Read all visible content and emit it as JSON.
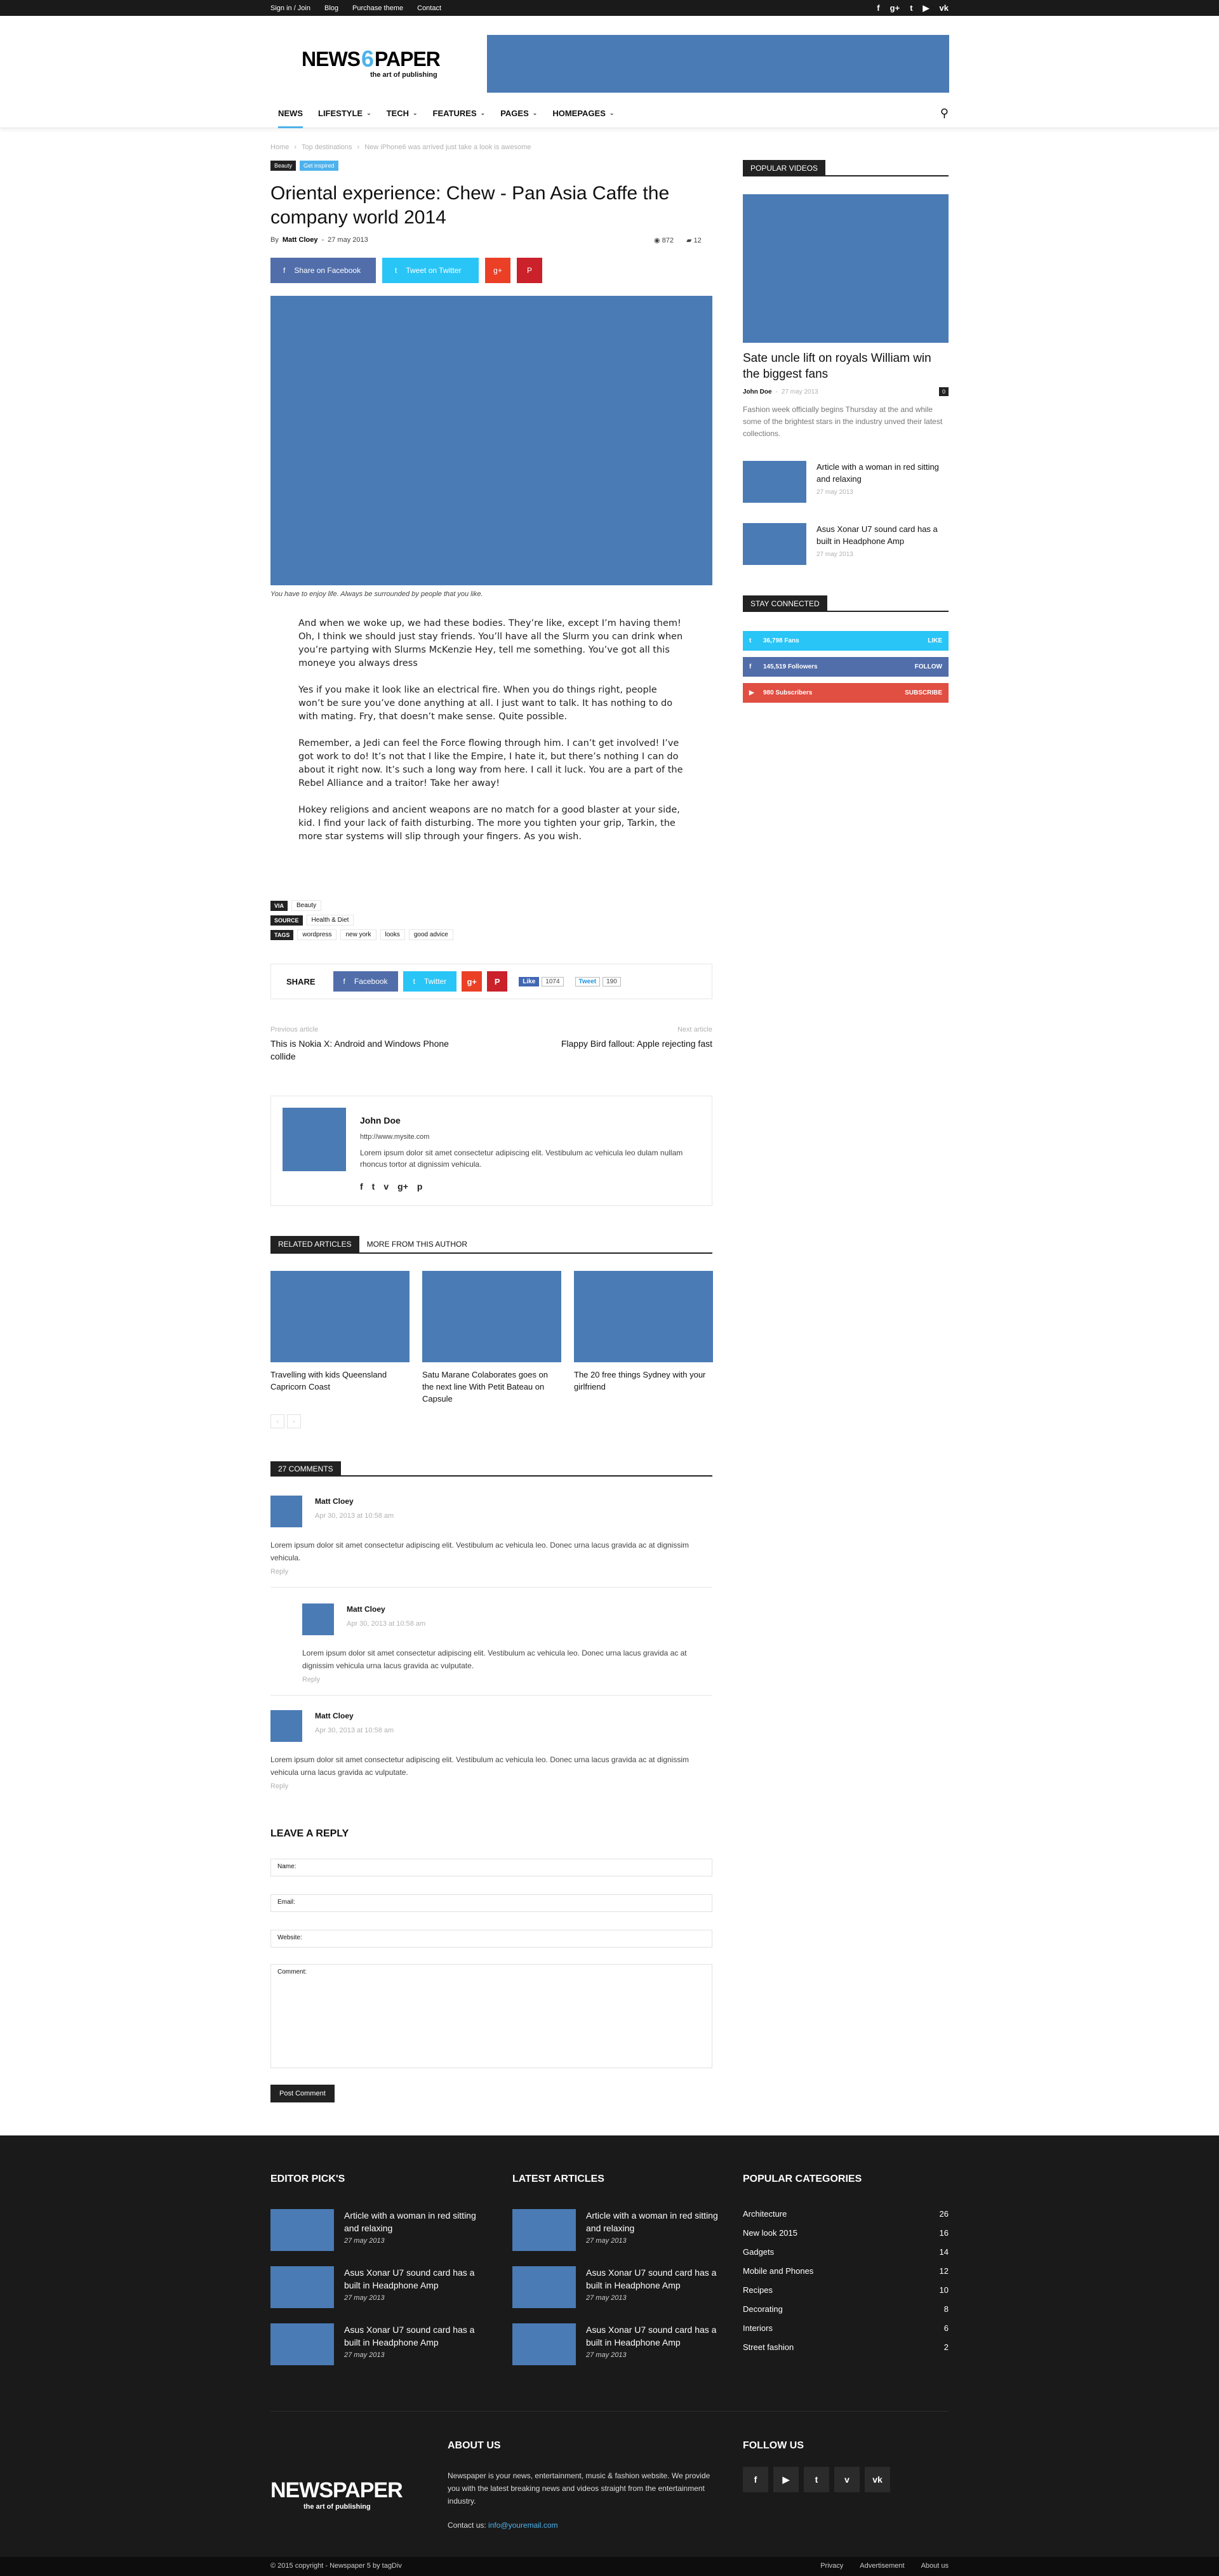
{
  "topbar": {
    "links": [
      "Sign in / Join",
      "Blog",
      "Purchase theme",
      "Contact"
    ],
    "social": [
      "f",
      "g+",
      "t",
      "▶",
      "vk"
    ]
  },
  "header": {
    "logo_text": "NEWS",
    "logo_mid": "6",
    "logo_text2": "PAPER",
    "logo_tag": "the art of publishing"
  },
  "nav": {
    "items": [
      {
        "label": "NEWS",
        "chev": ""
      },
      {
        "label": "LIFESTYLE",
        "chev": "⌄"
      },
      {
        "label": "TECH",
        "chev": "⌄"
      },
      {
        "label": "FEATURES",
        "chev": "⌄"
      },
      {
        "label": "PAGES",
        "chev": "⌄"
      },
      {
        "label": "HOMEPAGES",
        "chev": "⌄"
      }
    ],
    "search": "⚲"
  },
  "article": {
    "breadcrumbs": [
      "Home",
      "›",
      "Top destinations",
      "›",
      "New iPhone6 was arrived just take a look is awesome"
    ],
    "categories": [
      "Beauty",
      "Get inspired"
    ],
    "title": "Oriental experience: Chew - Pan Asia Caffe the company world 2014",
    "author_prefix": "By",
    "author": "Matt Cloey",
    "date_sep": "-",
    "date": "27 may 2013",
    "views": "872",
    "comments": "12",
    "share": {
      "facebook": "Share on Facebook",
      "twitter": "Tweet on Twitter",
      "gplus": "g+",
      "pinterest": "P"
    },
    "caption": "You have to enjoy life. Always be surrounded by people that you like.",
    "paragraphs": [
      "And when we woke up, we had these bodies. They’re like, except I’m having them! Oh, I think we should just stay friends. You’ll have all the Slurm you can drink when you’re partying with Slurms McKenzie Hey, tell me something. You’ve got all this moneye you always dress",
      "Yes if you make it look like an electrical fire. When you do things right, people won’t be sure you’ve done anything at all. I just want to talk. It has nothing to do with mating. Fry, that doesn’t make sense. Quite possible.",
      "Remember, a Jedi can feel the Force flowing through him. I can’t get involved! I’ve got work to do! It’s not that I like the Empire, I hate it, but there’s nothing I can do about it right now. It’s such a long way from here. I call it luck. You are a part of the Rebel Alliance and a traitor! Take her away!",
      "Hokey religions and ancient weapons are no match for a good blaster at your side, kid. I find your lack of faith disturbing. The more you tighten your grip, Tarkin, the more star systems will slip through your fingers. As you wish."
    ],
    "via": {
      "k": "VIA",
      "v": "Beauty"
    },
    "source": {
      "k": "SOURCE",
      "v": "Health & Diet"
    },
    "tags": {
      "k": "TAGS",
      "v": [
        "wordpress",
        "new york",
        "looks",
        "good advice"
      ]
    },
    "sharebox": {
      "label": "SHARE",
      "facebook": "Facebook",
      "twitter": "Twitter",
      "gplus": "g+",
      "pinterest": "P",
      "like": "Like",
      "like_count": "1074",
      "tweet": "Tweet",
      "tweet_count": "190"
    },
    "prev": {
      "label": "Previous article",
      "title": "This is Nokia X: Android and Windows Phone collide"
    },
    "next": {
      "label": "Next article",
      "title": "Flappy Bird fallout: Apple rejecting fast"
    },
    "authorbox": {
      "name": "John Doe",
      "url": "http://www.mysite.com",
      "desc": "Lorem ipsum dolor sit amet consectetur adipiscing elit. Vestibulum ac vehicula leo dulam nullam rhoncus tortor at dignissim vehicula.",
      "icons": [
        "f",
        "t",
        "v",
        "g+",
        "p"
      ]
    },
    "tabs": [
      "RELATED ARTICLES",
      "MORE FROM THIS AUTHOR"
    ],
    "related": [
      "Travelling with kids Queensland Capricorn Coast",
      "Satu Marane Colaborates goes on the next line With Petit Bateau on Capsule",
      "The 20 free things Sydney with your girlfriend"
    ],
    "pager": [
      "‹",
      "›"
    ],
    "comments_title": "27 COMMENTS",
    "comment_list": [
      {
        "name": "Matt Cloey",
        "date": "Apr 30, 2013 at 10:58 am",
        "text": "Lorem ipsum dolor sit amet consectetur adipiscing elit. Vestibulum ac vehicula leo. Donec urna lacus gravida ac at dignissim vehicula.",
        "reply": "Reply"
      },
      {
        "name": "Matt Cloey",
        "date": "Apr 30, 2013 at 10:58 am",
        "text": "Lorem ipsum dolor sit amet consectetur adipiscing elit. Vestibulum ac vehicula leo. Donec urna lacus gravida ac at dignissim vehicula urna lacus gravida ac vulputate.",
        "reply": "Reply"
      },
      {
        "name": "Matt Cloey",
        "date": "Apr 30, 2013 at 10:58 am",
        "text": "Lorem ipsum dolor sit amet consectetur adipiscing elit. Vestibulum ac vehicula leo. Donec urna lacus gravida ac at dignissim vehicula urna lacus gravida ac vulputate.",
        "reply": "Reply"
      }
    ],
    "leave_reply": "LEAVE A REPLY",
    "form": {
      "name": "Name:",
      "email": "Email:",
      "website": "Website:",
      "comment": "Comment:",
      "submit": "Post Comment"
    }
  },
  "sidebar": {
    "popular_title": "POPULAR VIDEOS",
    "feature": {
      "title": "Sate uncle lift on royals William win the biggest fans",
      "author": "John Doe",
      "date": "27 may 2013",
      "count": "0",
      "desc": "Fashion week officially begins Thursday at the and while some of the brightest stars in the industry unved their latest collections."
    },
    "list": [
      {
        "title": "Article with a woman in red sitting and relaxing",
        "date": "27 may 2013"
      },
      {
        "title": "Asus Xonar U7 sound card has a built in Headphone Amp",
        "date": "27 may 2013"
      }
    ],
    "connected_title": "STAY CONNECTED",
    "connect": [
      {
        "icon": "f",
        "n": "36,798",
        "unit": "Fans",
        "act": "LIKE",
        "color": "#516eab"
      },
      {
        "icon": "t",
        "n": "145,519",
        "unit": "Followers",
        "act": "FOLLOW",
        "color": "#29c5f6"
      },
      {
        "icon": "▶",
        "n": "980",
        "unit": "Subscribers",
        "act": "SUBSCRIBE",
        "color": "#e14e42"
      }
    ]
  },
  "footer": {
    "editor_title": "EDITOR PICK'S",
    "latest_title": "LATEST ARTICLES",
    "popular_title": "POPULAR CATEGORIES",
    "editor": [
      {
        "title": "Article with a woman in red sitting and relaxing",
        "date": "27 may 2013"
      },
      {
        "title": "Asus Xonar U7 sound card has a built in Headphone Amp",
        "date": "27 may 2013"
      },
      {
        "title": "Asus Xonar U7 sound card has a built in Headphone Amp",
        "date": "27 may 2013"
      }
    ],
    "latest": [
      {
        "title": "Article with a woman in red sitting and relaxing",
        "date": "27 may 2013"
      },
      {
        "title": "Asus Xonar U7 sound card has a built in Headphone Amp",
        "date": "27 may 2013"
      },
      {
        "title": "Asus Xonar U7 sound card has a built in Headphone Amp",
        "date": "27 may 2013"
      }
    ],
    "categories": [
      {
        "n": "Architecture",
        "c": "26"
      },
      {
        "n": "New look 2015",
        "c": "16"
      },
      {
        "n": "Gadgets",
        "c": "14"
      },
      {
        "n": "Mobile and Phones",
        "c": "12"
      },
      {
        "n": "Recipes",
        "c": "10"
      },
      {
        "n": "Decorating",
        "c": "8"
      },
      {
        "n": "Interiors",
        "c": "6"
      },
      {
        "n": "Street fashion",
        "c": "2"
      }
    ],
    "logo": "NEWSPAPER",
    "logo_tag": "the art of publishing",
    "about_title": "ABOUT US",
    "about": "Newspaper is your news, entertainment, music & fashion website. We provide you with the latest breaking news and videos straight from the entertainment industry.",
    "contact_label": "Contact us:",
    "contact_email": "info@youremail.com",
    "follow_title": "FOLLOW US",
    "follow_icons": [
      "f",
      "▶",
      "t",
      "v",
      "vk"
    ],
    "copyright": "© 2015 copyright - Newspaper 5 by tagDiv",
    "bottom_links": [
      "Privacy",
      "Advertisement",
      "About us"
    ]
  }
}
